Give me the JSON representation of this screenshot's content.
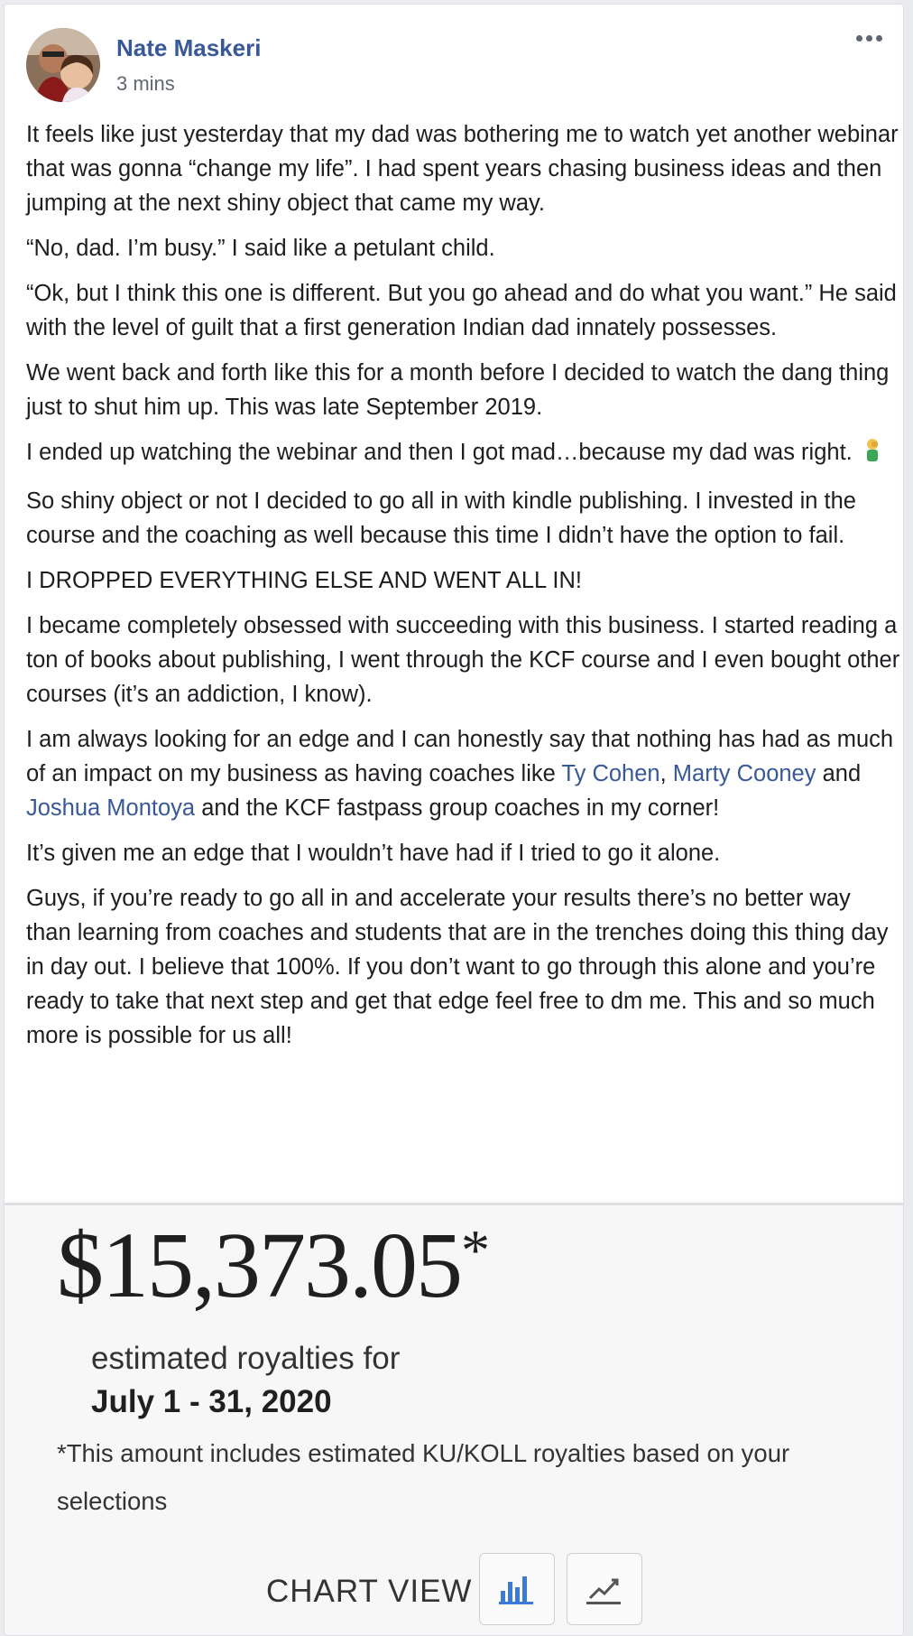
{
  "post": {
    "author": "Nate Maskeri",
    "timestamp": "3 mins",
    "paragraphs": {
      "p1": "It feels like just yesterday that my dad was bothering me to watch yet another webinar that was gonna “change my life”. I had spent years chasing business ideas and then jumping at the next shiny object that came my way.",
      "p2": "“No, dad. I’m busy.” I said like a petulant child.",
      "p3": "“Ok, but I think this one is different. But you go ahead and do what you want.” He said with the level of guilt that a first generation Indian dad innately possesses.",
      "p4": "We went back and forth like this for a month before I decided to watch the dang thing just to shut him up. This was late September 2019.",
      "p5": "I ended up watching the webinar and then I got mad…because my dad was right.",
      "p6": "So shiny object or not I decided to go all in with kindle publishing. I invested in the course and the coaching as well because this time I didn’t have the option to fail.",
      "p7": "I DROPPED EVERYTHING ELSE AND WENT ALL IN!",
      "p8": "I became completely obsessed with succeeding with this business. I started reading a ton of books about publishing, I went through the KCF course and I even bought other courses (it’s an addiction, I know).",
      "p9_a": "I am always looking for an edge and I can honestly say that nothing has had as much of an impact on my business as having coaches like ",
      "p9_link1": "Ty Cohen",
      "p9_b": ", ",
      "p9_link2": "Marty Cooney",
      "p9_c": " and ",
      "p9_link3": "Joshua Montoya",
      "p9_d": " and the KCF fastpass group coaches in my corner!",
      "p10": "It’s given me an edge that I wouldn’t have had if I tried to go it alone.",
      "p11": "Guys, if you’re ready to go all in and accelerate your results there’s no better way than learning from coaches and students that are in the trenches doing this thing day in day out. I believe that 100%. If you don’t want to go through this alone and you’re ready to take that next step and get that edge feel free to dm me. This and so much more is possible for us all!"
    },
    "emoji_icon": "man-facepalming-icon"
  },
  "royalties": {
    "amount": "$15,373.05",
    "asterisk": "*",
    "label": "estimated royalties for",
    "range": "July 1 - 31, 2020",
    "note": "*This amount includes estimated KU/KOLL royalties based on your selections",
    "chart_view_label": "CHART VIEW"
  },
  "icons": {
    "more": "more-options-icon",
    "bar_chart": "bar-chart-icon",
    "line_chart": "line-chart-icon"
  },
  "colors": {
    "link": "#385898",
    "text": "#1c1e21",
    "bar_icon": "#3a7bd5",
    "line_icon": "#555555"
  }
}
